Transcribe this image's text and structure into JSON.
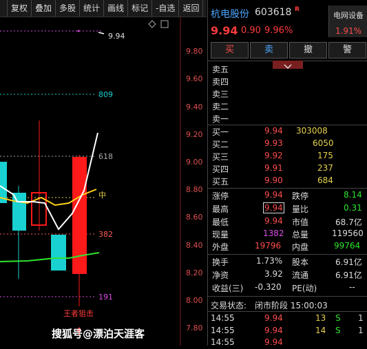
{
  "toolbar": {
    "items": [
      "复权",
      "叠加",
      "多股",
      "统计",
      "画线",
      "标记",
      "-自选",
      "返回"
    ]
  },
  "chart": {
    "price_axis": [
      "9.80",
      "9.60",
      "9.40",
      "9.20",
      "9.00",
      "8.80",
      "8.60",
      "8.40",
      "8.20",
      "8.00",
      "7.80"
    ],
    "fib_labels": {
      "top": "9.94",
      "f809": "809",
      "f618": "618",
      "f500": "中",
      "f382": "382",
      "f191": "191"
    },
    "annotation": "王者狙击",
    "colors": {
      "up": "#ff1a1a",
      "down": "#19d1d1",
      "ma_white": "#ffffff",
      "ma_yellow": "#ffd21a",
      "ma_green": "#2ee62e",
      "fib_cyan": "#19d1d1",
      "fib_gray": "#aaaaaa",
      "fib_red": "#ff5c5c",
      "fib_purple": "#d94de6"
    }
  },
  "quote": {
    "name": "杭电股份",
    "code": "603618",
    "tag": "R",
    "sector_name": "电网设备",
    "sector_pct": "1.91%",
    "price": "9.94",
    "change": "0.90",
    "change_pct": "9.96%"
  },
  "buttons": {
    "buy": "买",
    "sell": "卖",
    "cancel": "撤",
    "alert": "警"
  },
  "asks": [
    {
      "label": "卖五",
      "price": "",
      "vol": ""
    },
    {
      "label": "卖四",
      "price": "",
      "vol": ""
    },
    {
      "label": "卖三",
      "price": "",
      "vol": ""
    },
    {
      "label": "卖二",
      "price": "",
      "vol": ""
    },
    {
      "label": "卖一",
      "price": "",
      "vol": ""
    }
  ],
  "bids": [
    {
      "label": "买一",
      "price": "9.94",
      "vol": "303008"
    },
    {
      "label": "买二",
      "price": "9.93",
      "vol": "6050"
    },
    {
      "label": "买三",
      "price": "9.92",
      "vol": "175"
    },
    {
      "label": "买四",
      "price": "9.91",
      "vol": "237"
    },
    {
      "label": "买五",
      "price": "9.90",
      "vol": "684"
    }
  ],
  "stats": {
    "limit_up_label": "涨停",
    "limit_up": "9.94",
    "limit_down_label": "跌停",
    "limit_down": "8.14",
    "high_label": "最高",
    "high": "9.94",
    "vol_ratio_label": "量比",
    "vol_ratio": "0.31",
    "low_label": "最低",
    "low": "9.94",
    "mkt_cap_label": "市值",
    "mkt_cap": "68.7亿",
    "cur_vol_label": "现量",
    "cur_vol": "1382",
    "total_vol_label": "总量",
    "total_vol": "119560",
    "outer_label": "外盘",
    "outer": "19796",
    "inner_label": "内盘",
    "inner": "99764",
    "turnover_label": "换手",
    "turnover": "1.73%",
    "shares_label": "股本",
    "shares": "6.91亿",
    "nav_label": "净资",
    "nav": "3.92",
    "float_label": "流通",
    "float": "6.91亿",
    "eps_label": "收益(三)",
    "eps": "-0.320",
    "pe_label": "PE(动)",
    "pe": "--"
  },
  "status": {
    "label": "交易状态:",
    "value": "闭市阶段 15:00:03"
  },
  "ticks": [
    {
      "time": "14:55",
      "price": "9.94",
      "vol": "13",
      "side": "S",
      "count": "1"
    },
    {
      "time": "14:55",
      "price": "9.94",
      "vol": "14",
      "side": "S",
      "count": "1"
    },
    {
      "time": "14:55",
      "price": "9.94",
      "vol": "",
      "side": "",
      "count": ""
    }
  ],
  "watermark": "搜狐号@漂泊天涯客"
}
